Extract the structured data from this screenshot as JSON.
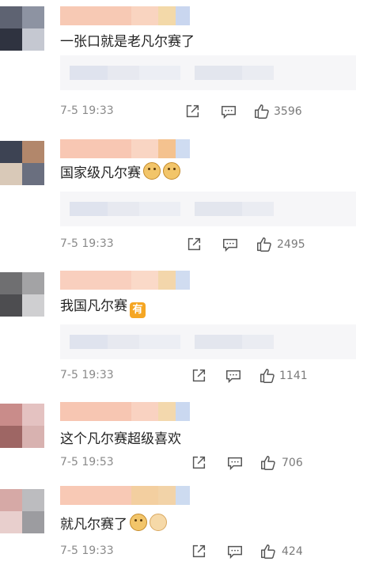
{
  "comments": [
    {
      "text": "一张口就是老凡尔赛了",
      "emojis": [],
      "time": "7-5 19:33",
      "likes": "3596",
      "avatar_colors": [
        "#5e6372",
        "#8d93a2",
        "#2f3340",
        "#c5c8d1"
      ],
      "name_colors": [
        "#f7c9b4",
        "#f9d4c0",
        "#f3d9a9",
        "#c9d6ef"
      ]
    },
    {
      "text": "国家级凡尔赛",
      "emojis": [
        "doge-icon",
        "doge-icon"
      ],
      "time": "7-5 19:33",
      "likes": "2495",
      "avatar_colors": [
        "#3d4353",
        "#b2876b",
        "#d9c9b8",
        "#6a6f7f"
      ],
      "name_colors": [
        "#f8c7b3",
        "#f9d5c3",
        "#f4c28f",
        "#cfdcf1"
      ]
    },
    {
      "text": "我国凡尔赛",
      "emojis": [
        "you-icon"
      ],
      "time": "7-5 19:33",
      "likes": "1141",
      "avatar_colors": [
        "#6f6f71",
        "#a3a3a5",
        "#4d4d50",
        "#cfcfd1"
      ],
      "name_colors": [
        "#f9cfbe",
        "#fad9c8",
        "#f3d6ab",
        "#d0dcf0"
      ]
    },
    {
      "text": "这个凡尔赛超级喜欢",
      "emojis": [],
      "time": "7-5 19:53",
      "likes": "706",
      "avatar_colors": [
        "#c98c8a",
        "#e4c2c1",
        "#9e6664",
        "#d8b2b0"
      ],
      "name_colors": [
        "#f7c6b2",
        "#f9d2c1",
        "#f3d8ad",
        "#cad8f0"
      ]
    },
    {
      "text": "就凡尔赛了",
      "emojis": [
        "doge-icon",
        "fist-icon"
      ],
      "time": "7-5 19:33",
      "likes": "424",
      "avatar_colors": [
        "#d6a9a6",
        "#bcbcbf",
        "#e8cfcd",
        "#9c9ca0"
      ],
      "name_colors": [
        "#f8c9b5",
        "#f3cfa0",
        "#f2d3a8",
        "#cddbf0"
      ]
    }
  ],
  "icons": {
    "share": "share-icon",
    "comment": "comment-icon",
    "like": "thumbs-up-icon"
  },
  "colors": {
    "time": "#8a8a8a",
    "reply_bg": "#f6f6f8"
  }
}
